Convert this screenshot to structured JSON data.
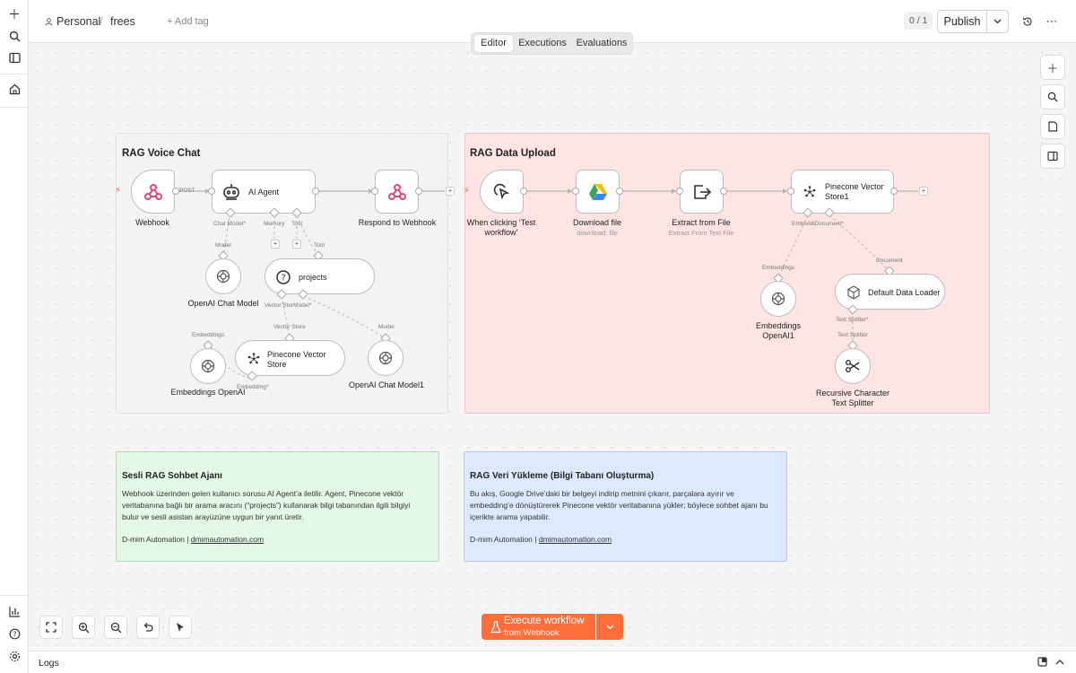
{
  "breadcrumb": {
    "owner": "Personal",
    "separator": "/",
    "workflow_name": "frees"
  },
  "header": {
    "add_tag": "+ Add tag",
    "version_counter": "0 / 1",
    "publish_label": "Publish"
  },
  "tabs": [
    {
      "label": "Editor",
      "active": true
    },
    {
      "label": "Executions"
    },
    {
      "label": "Evaluations"
    }
  ],
  "groups": {
    "voice": {
      "title": "RAG Voice Chat",
      "color": "#f3f3f3"
    },
    "upload": {
      "title": "RAG Data Upload",
      "color": "#ffe4e4"
    }
  },
  "nodes": {
    "webhook": {
      "label": "Webhook"
    },
    "agent": {
      "label": "AI Agent"
    },
    "respond": {
      "label": "Respond to Webhook"
    },
    "chat_model": {
      "label": "OpenAI Chat Model"
    },
    "projects": {
      "label": "projects"
    },
    "pinecone_store": {
      "label": "Pinecone Vector Store"
    },
    "chat_model1": {
      "label": "OpenAI Chat Model1"
    },
    "embeddings": {
      "label": "Embeddings OpenAI"
    },
    "manual": {
      "label": "When clicking ‘Test workflow’"
    },
    "download": {
      "label": "Download file",
      "sub": "download: file"
    },
    "extract": {
      "label": "Extract from File",
      "sub": "Extract From Text File"
    },
    "pinecone_store1": {
      "label": "Pinecone Vector Store1"
    },
    "data_loader": {
      "label": "Default Data Loader"
    },
    "embeddings1": {
      "label": "Embeddings OpenAI1"
    },
    "splitter": {
      "label": "Recursive Character Text Splitter"
    }
  },
  "connection_labels": {
    "post": "POST",
    "chat_model_req": "Chat Model*",
    "memory": "Memory",
    "tool": "Tool",
    "model": "Model",
    "tool2": "Tool",
    "vector_store_model": "Vector StorModel*",
    "vector_store": "Vector Store",
    "model2": "Model",
    "embeddings": "Embeddings",
    "embedding_req": "Embedding*",
    "embedd_document": "EmbeddiDocument*",
    "embeddings2": "Embeddings",
    "document": "Document",
    "text_splitter_req": "Text Splitter*",
    "text_splitter": "Text Splitter"
  },
  "notes": {
    "voice": {
      "title": "Sesli RAG Sohbet Ajanı",
      "body_lines": [
        "Webhook üzerinden gelen kullanıcı sorusu AI Agent’a iletilir. Agent, Pinecone vektör",
        "veritabanına bağlı bir arama aracını (“projects”) kullanarak bilgi tabanından ilgili bilgiyi",
        "bulur ve sesli asistan arayüzüne uygun bir yanıt üretir."
      ],
      "footer_text": "D-mim Automation |",
      "footer_link": "dmimautomation.com",
      "color": "#e3f8e6"
    },
    "upload": {
      "title": "RAG Veri Yükleme (Bilgi Tabanı Oluşturma)",
      "body_lines": [
        "Bu akış, Google Drive’daki bir belgeyi indirip metnini çıkarır, parçalara ayırır ve",
        "embedding’e dönüştürerek Pinecone vektör veritabanına yükler; böylece sohbet ajanı bu",
        "içerikte arama yapabilir."
      ],
      "footer_text": "D-mim Automation |",
      "footer_link": "dmimautomation.com",
      "color": "#dde9ff"
    }
  },
  "execute": {
    "title": "Execute workflow",
    "subtitle": "from Webhook",
    "color": "#ff6d3a"
  },
  "logs": {
    "label": "Logs"
  },
  "icons": {
    "left": [
      "plus-icon",
      "search-icon",
      "sidebar-toggle-icon",
      "home-icon",
      "insights-icon",
      "help-icon",
      "settings-icon"
    ],
    "right": [
      "add-node-icon",
      "search-nodes-icon",
      "sticky-note-icon",
      "panel-icon"
    ],
    "bottom": [
      "fit-view-icon",
      "zoom-in-icon",
      "zoom-out-icon",
      "undo-icon",
      "cursor-icon"
    ]
  }
}
